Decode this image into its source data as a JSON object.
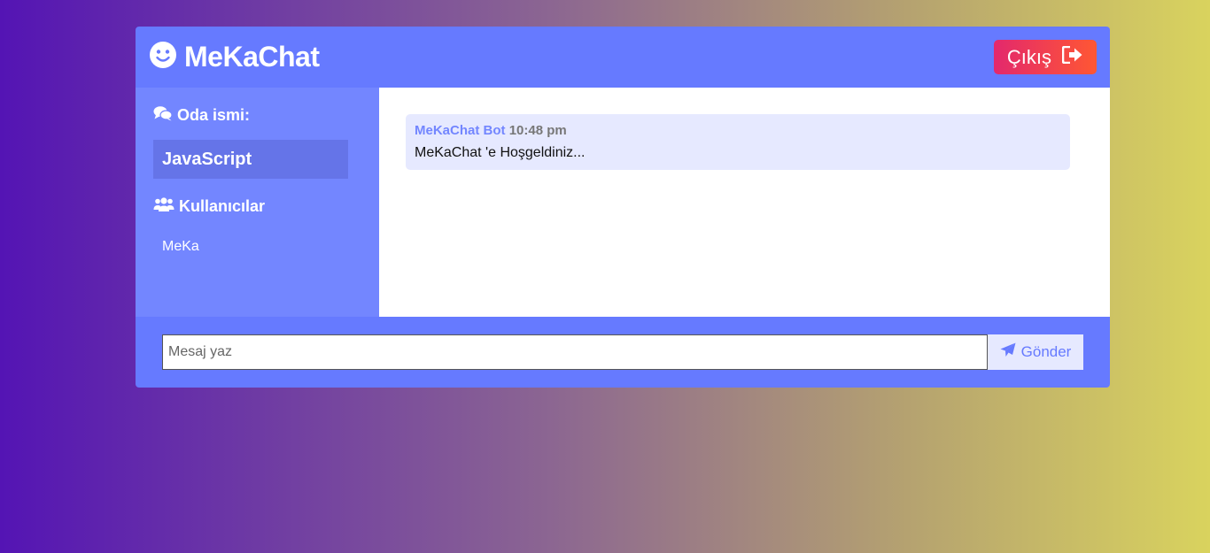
{
  "header": {
    "brand_icon": "smile-icon",
    "title": "MeKaChat",
    "logout_label": "Çıkış",
    "logout_icon": "sign-out-icon"
  },
  "sidebar": {
    "room_heading_icon": "comments-icon",
    "room_heading": "Oda ismi:",
    "room_name": "JavaScript",
    "users_heading_icon": "users-icon",
    "users_heading": "Kullanıcılar",
    "users": [
      "MeKa"
    ]
  },
  "messages": [
    {
      "user": "MeKaChat Bot",
      "time": "10:48 pm",
      "text": "MeKaChat 'e Hoşgeldiniz..."
    }
  ],
  "form": {
    "placeholder": "Mesaj yaz",
    "send_label": "Gönder",
    "send_icon": "paper-plane-icon"
  },
  "colors": {
    "header_bg": "#667aff",
    "sidebar_bg": "#7386ff",
    "room_name_bg": "#6574e8",
    "message_bg": "#e6e9ff",
    "logout_gradient_start": "#e3286d",
    "logout_gradient_end": "#ff5733"
  }
}
